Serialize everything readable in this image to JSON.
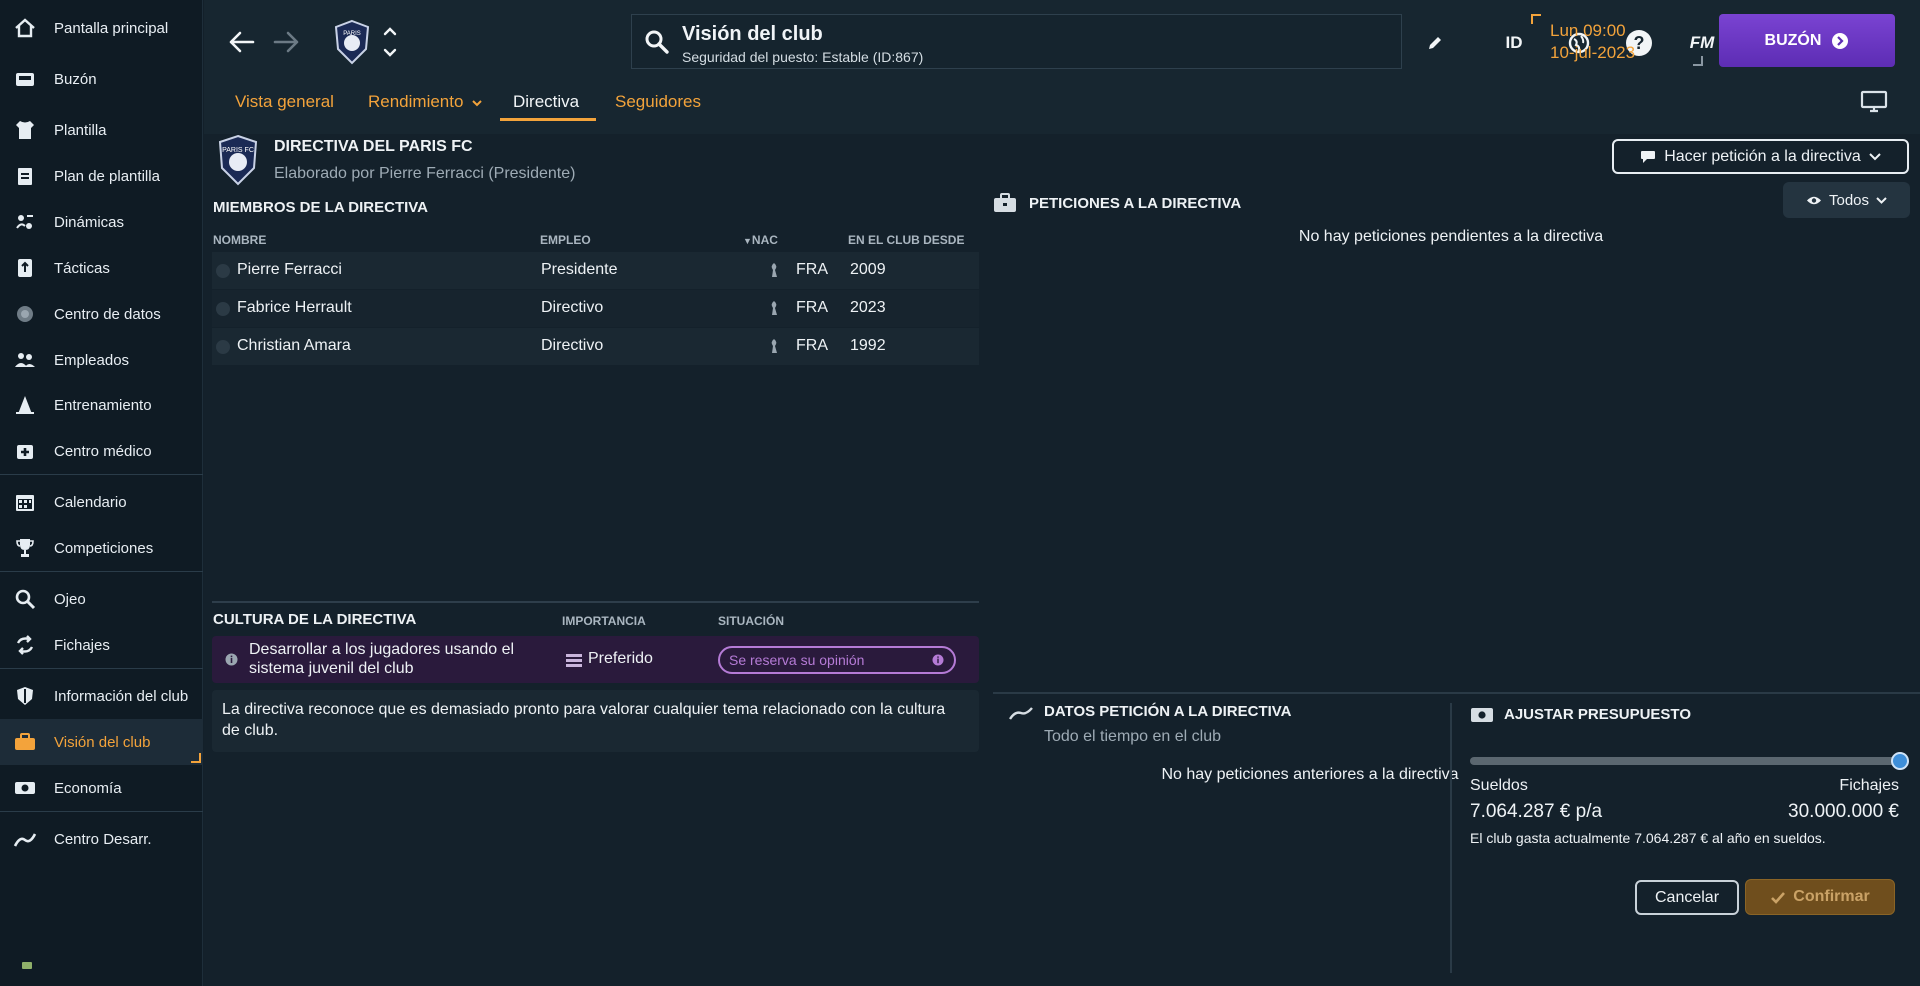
{
  "sidebar": {
    "items": [
      {
        "label": "Pantalla principal",
        "icon": "home-icon"
      },
      {
        "label": "Buzón",
        "icon": "inbox-icon"
      },
      {
        "label": "Plantilla",
        "icon": "shirt-icon"
      },
      {
        "label": "Plan de plantilla",
        "icon": "clipboard-icon"
      },
      {
        "label": "Dinámicas",
        "icon": "dynamics-icon"
      },
      {
        "label": "Tácticas",
        "icon": "tactics-icon"
      },
      {
        "label": "Centro de datos",
        "icon": "data-hub-icon"
      },
      {
        "label": "Empleados",
        "icon": "staff-icon"
      },
      {
        "label": "Entrenamiento",
        "icon": "training-cone-icon"
      },
      {
        "label": "Centro médico",
        "icon": "medical-icon"
      },
      {
        "label": "Calendario",
        "icon": "calendar-icon"
      },
      {
        "label": "Competiciones",
        "icon": "trophy-icon"
      },
      {
        "label": "Ojeo",
        "icon": "search-icon"
      },
      {
        "label": "Fichajes",
        "icon": "transfer-icon"
      },
      {
        "label": "Información del club",
        "icon": "shield-icon"
      },
      {
        "label": "Visión del club",
        "icon": "briefcase-icon"
      },
      {
        "label": "Economía",
        "icon": "money-icon"
      },
      {
        "label": "Centro Desarr.",
        "icon": "development-icon"
      }
    ],
    "active_index": 15
  },
  "header": {
    "title": "Visión del club",
    "subtitle": "Seguridad del puesto: Estable (ID:867)",
    "id_label": "ID",
    "fm_label": "FM",
    "help_label": "?",
    "date_line1": "Lun 09:00",
    "date_line2": "10-jul-2023",
    "mailbox_label": "BUZÓN",
    "tabs": [
      {
        "label": "Vista general"
      },
      {
        "label": "Rendimiento"
      },
      {
        "label": "Directiva"
      },
      {
        "label": "Seguidores"
      }
    ]
  },
  "board": {
    "title": "DIRECTIVA DEL PARIS FC",
    "subtitle": "Elaborado por Pierre Ferracci (Presidente)",
    "crest_text": "PARIS FC",
    "members_title": "MIEMBROS DE LA DIRECTIVA",
    "columns": [
      "NOMBRE",
      "EMPLEO",
      "NAC",
      "EN EL CLUB DESDE"
    ],
    "members": [
      {
        "name": "Pierre Ferracci",
        "role": "Presidente",
        "nat": "FRA",
        "since": "2009"
      },
      {
        "name": "Fabrice Herrault",
        "role": "Directivo",
        "nat": "FRA",
        "since": "2023"
      },
      {
        "name": "Christian Amara",
        "role": "Directivo",
        "nat": "FRA",
        "since": "1992"
      }
    ]
  },
  "culture": {
    "title": "CULTURA DE LA DIRECTIVA",
    "col_importance": "IMPORTANCIA",
    "col_situation": "SITUACIÓN",
    "item_text": "Desarrollar a los jugadores usando el sistema juvenil del club",
    "importance": "Preferido",
    "situation": "Se reserva su opinión",
    "note": "La directiva reconoce que es demasiado pronto para valorar cualquier tema relacionado con la cultura de club."
  },
  "requests": {
    "make_request_label": "Hacer petición a la directiva",
    "title": "PETICIONES A LA DIRECTIVA",
    "filter_label": "Todos",
    "empty_text": "No hay peticiones pendientes a la directiva"
  },
  "request_data": {
    "title": "DATOS PETICIÓN A LA DIRECTIVA",
    "subtitle": "Todo el tiempo en el club",
    "empty_text": "No hay peticiones anteriores a la directiva"
  },
  "budget": {
    "title": "AJUSTAR PRESUPUESTO",
    "slider_fraction": 1.0,
    "wages_label": "Sueldos",
    "transfers_label": "Fichajes",
    "wages_value": "7.064.287 € p/a",
    "transfers_value": "30.000.000 €",
    "note": "El club gasta actualmente 7.064.287 € al año en sueldos.",
    "cancel_label": "Cancelar",
    "confirm_label": "Confirmar"
  },
  "colors": {
    "accent": "#f3a33b",
    "mailbox": "#6b36c4",
    "culture_row": "#2a1a3c",
    "situation_pill": "#b57bd6"
  }
}
